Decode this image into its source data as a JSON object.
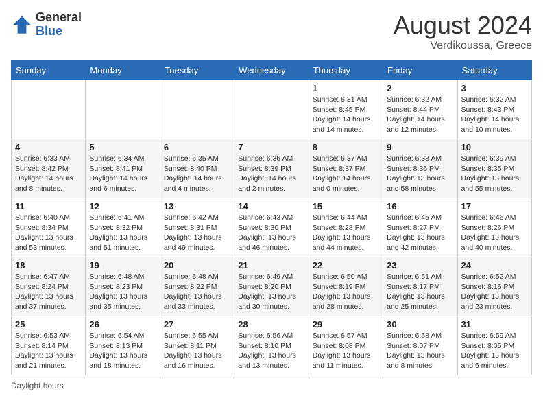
{
  "header": {
    "logo_general": "General",
    "logo_blue": "Blue",
    "month_year": "August 2024",
    "location": "Verdikoussa, Greece"
  },
  "weekdays": [
    "Sunday",
    "Monday",
    "Tuesday",
    "Wednesday",
    "Thursday",
    "Friday",
    "Saturday"
  ],
  "weeks": [
    [
      {
        "day": "",
        "sunrise": "",
        "sunset": "",
        "daylight": ""
      },
      {
        "day": "",
        "sunrise": "",
        "sunset": "",
        "daylight": ""
      },
      {
        "day": "",
        "sunrise": "",
        "sunset": "",
        "daylight": ""
      },
      {
        "day": "",
        "sunrise": "",
        "sunset": "",
        "daylight": ""
      },
      {
        "day": "1",
        "sunrise": "Sunrise: 6:31 AM",
        "sunset": "Sunset: 8:45 PM",
        "daylight": "Daylight: 14 hours and 14 minutes."
      },
      {
        "day": "2",
        "sunrise": "Sunrise: 6:32 AM",
        "sunset": "Sunset: 8:44 PM",
        "daylight": "Daylight: 14 hours and 12 minutes."
      },
      {
        "day": "3",
        "sunrise": "Sunrise: 6:32 AM",
        "sunset": "Sunset: 8:43 PM",
        "daylight": "Daylight: 14 hours and 10 minutes."
      }
    ],
    [
      {
        "day": "4",
        "sunrise": "Sunrise: 6:33 AM",
        "sunset": "Sunset: 8:42 PM",
        "daylight": "Daylight: 14 hours and 8 minutes."
      },
      {
        "day": "5",
        "sunrise": "Sunrise: 6:34 AM",
        "sunset": "Sunset: 8:41 PM",
        "daylight": "Daylight: 14 hours and 6 minutes."
      },
      {
        "day": "6",
        "sunrise": "Sunrise: 6:35 AM",
        "sunset": "Sunset: 8:40 PM",
        "daylight": "Daylight: 14 hours and 4 minutes."
      },
      {
        "day": "7",
        "sunrise": "Sunrise: 6:36 AM",
        "sunset": "Sunset: 8:39 PM",
        "daylight": "Daylight: 14 hours and 2 minutes."
      },
      {
        "day": "8",
        "sunrise": "Sunrise: 6:37 AM",
        "sunset": "Sunset: 8:37 PM",
        "daylight": "Daylight: 14 hours and 0 minutes."
      },
      {
        "day": "9",
        "sunrise": "Sunrise: 6:38 AM",
        "sunset": "Sunset: 8:36 PM",
        "daylight": "Daylight: 13 hours and 58 minutes."
      },
      {
        "day": "10",
        "sunrise": "Sunrise: 6:39 AM",
        "sunset": "Sunset: 8:35 PM",
        "daylight": "Daylight: 13 hours and 55 minutes."
      }
    ],
    [
      {
        "day": "11",
        "sunrise": "Sunrise: 6:40 AM",
        "sunset": "Sunset: 8:34 PM",
        "daylight": "Daylight: 13 hours and 53 minutes."
      },
      {
        "day": "12",
        "sunrise": "Sunrise: 6:41 AM",
        "sunset": "Sunset: 8:32 PM",
        "daylight": "Daylight: 13 hours and 51 minutes."
      },
      {
        "day": "13",
        "sunrise": "Sunrise: 6:42 AM",
        "sunset": "Sunset: 8:31 PM",
        "daylight": "Daylight: 13 hours and 49 minutes."
      },
      {
        "day": "14",
        "sunrise": "Sunrise: 6:43 AM",
        "sunset": "Sunset: 8:30 PM",
        "daylight": "Daylight: 13 hours and 46 minutes."
      },
      {
        "day": "15",
        "sunrise": "Sunrise: 6:44 AM",
        "sunset": "Sunset: 8:28 PM",
        "daylight": "Daylight: 13 hours and 44 minutes."
      },
      {
        "day": "16",
        "sunrise": "Sunrise: 6:45 AM",
        "sunset": "Sunset: 8:27 PM",
        "daylight": "Daylight: 13 hours and 42 minutes."
      },
      {
        "day": "17",
        "sunrise": "Sunrise: 6:46 AM",
        "sunset": "Sunset: 8:26 PM",
        "daylight": "Daylight: 13 hours and 40 minutes."
      }
    ],
    [
      {
        "day": "18",
        "sunrise": "Sunrise: 6:47 AM",
        "sunset": "Sunset: 8:24 PM",
        "daylight": "Daylight: 13 hours and 37 minutes."
      },
      {
        "day": "19",
        "sunrise": "Sunrise: 6:48 AM",
        "sunset": "Sunset: 8:23 PM",
        "daylight": "Daylight: 13 hours and 35 minutes."
      },
      {
        "day": "20",
        "sunrise": "Sunrise: 6:48 AM",
        "sunset": "Sunset: 8:22 PM",
        "daylight": "Daylight: 13 hours and 33 minutes."
      },
      {
        "day": "21",
        "sunrise": "Sunrise: 6:49 AM",
        "sunset": "Sunset: 8:20 PM",
        "daylight": "Daylight: 13 hours and 30 minutes."
      },
      {
        "day": "22",
        "sunrise": "Sunrise: 6:50 AM",
        "sunset": "Sunset: 8:19 PM",
        "daylight": "Daylight: 13 hours and 28 minutes."
      },
      {
        "day": "23",
        "sunrise": "Sunrise: 6:51 AM",
        "sunset": "Sunset: 8:17 PM",
        "daylight": "Daylight: 13 hours and 25 minutes."
      },
      {
        "day": "24",
        "sunrise": "Sunrise: 6:52 AM",
        "sunset": "Sunset: 8:16 PM",
        "daylight": "Daylight: 13 hours and 23 minutes."
      }
    ],
    [
      {
        "day": "25",
        "sunrise": "Sunrise: 6:53 AM",
        "sunset": "Sunset: 8:14 PM",
        "daylight": "Daylight: 13 hours and 21 minutes."
      },
      {
        "day": "26",
        "sunrise": "Sunrise: 6:54 AM",
        "sunset": "Sunset: 8:13 PM",
        "daylight": "Daylight: 13 hours and 18 minutes."
      },
      {
        "day": "27",
        "sunrise": "Sunrise: 6:55 AM",
        "sunset": "Sunset: 8:11 PM",
        "daylight": "Daylight: 13 hours and 16 minutes."
      },
      {
        "day": "28",
        "sunrise": "Sunrise: 6:56 AM",
        "sunset": "Sunset: 8:10 PM",
        "daylight": "Daylight: 13 hours and 13 minutes."
      },
      {
        "day": "29",
        "sunrise": "Sunrise: 6:57 AM",
        "sunset": "Sunset: 8:08 PM",
        "daylight": "Daylight: 13 hours and 11 minutes."
      },
      {
        "day": "30",
        "sunrise": "Sunrise: 6:58 AM",
        "sunset": "Sunset: 8:07 PM",
        "daylight": "Daylight: 13 hours and 8 minutes."
      },
      {
        "day": "31",
        "sunrise": "Sunrise: 6:59 AM",
        "sunset": "Sunset: 8:05 PM",
        "daylight": "Daylight: 13 hours and 6 minutes."
      }
    ]
  ],
  "footer": {
    "note": "Daylight hours"
  }
}
